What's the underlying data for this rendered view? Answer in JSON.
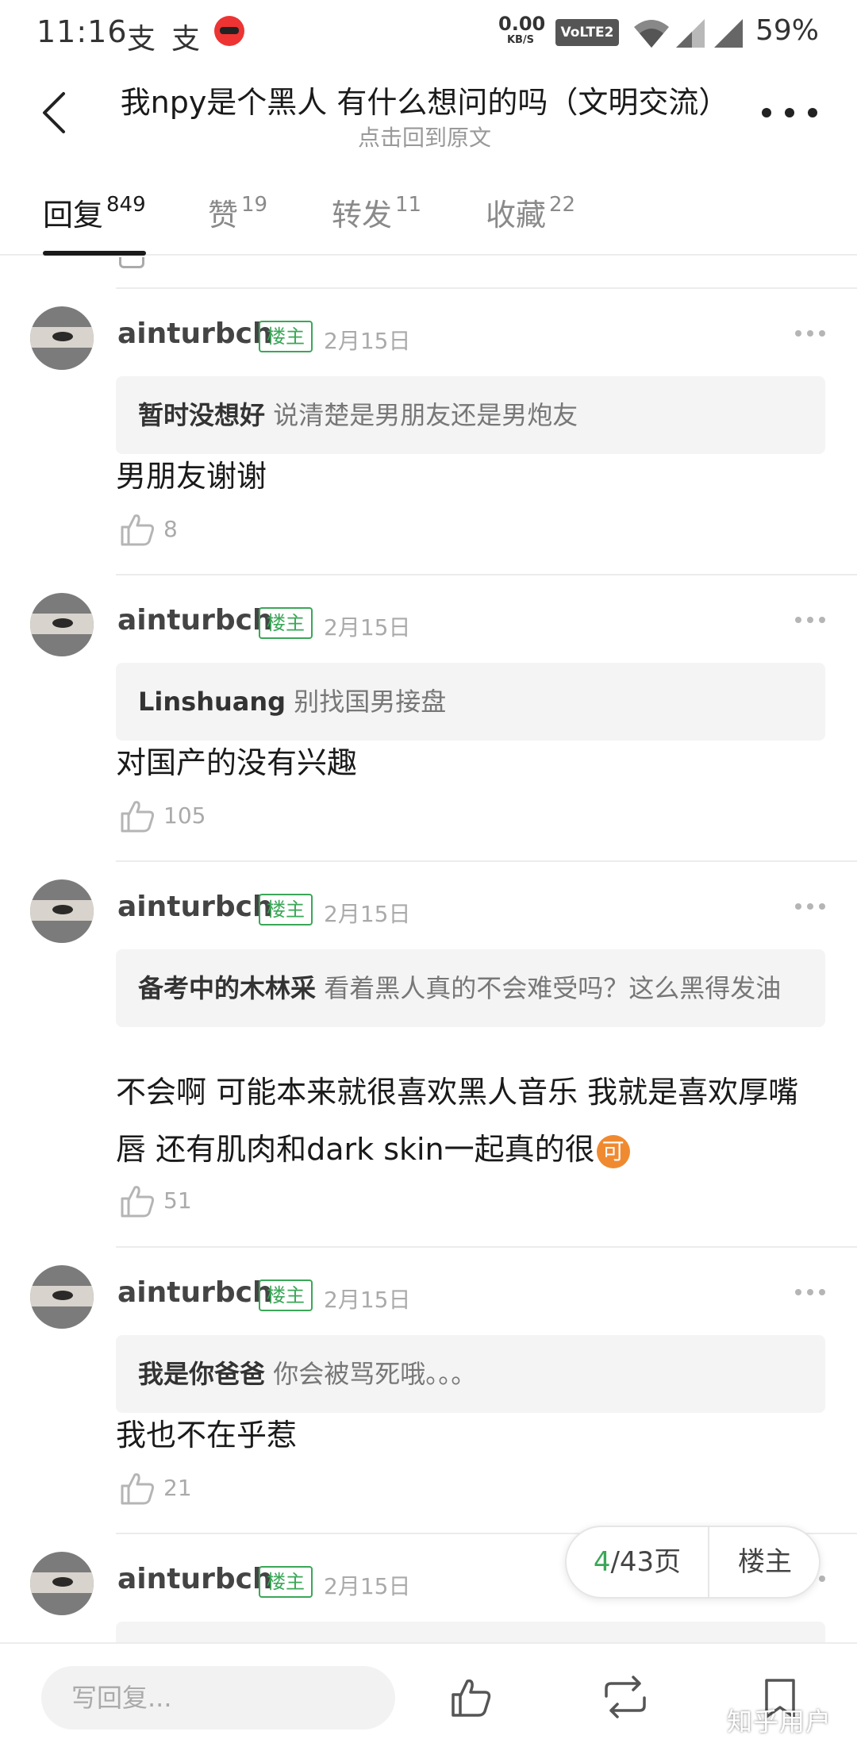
{
  "status_bar": {
    "time": "11:16",
    "notif_glyph": "支",
    "net_speed_value": "0.00",
    "net_speed_unit": "KB/S",
    "volte": "VoLTE2",
    "battery": "59%"
  },
  "header": {
    "title": "我npy是个黑人 有什么想问的吗（文明交流）",
    "subtitle": "点击回到原文"
  },
  "tabs": [
    {
      "label": "回复",
      "count": "849"
    },
    {
      "label": "赞",
      "count": "19"
    },
    {
      "label": "转发",
      "count": "11"
    },
    {
      "label": "收藏",
      "count": "22"
    }
  ],
  "comments": [
    {
      "user": "ainturbch",
      "badge": "楼主",
      "date": "2月15日",
      "quote_user": "暂时没想好",
      "quote_text": "说清楚是男朋友还是男炮友",
      "text": "男朋友谢谢",
      "likes": "8"
    },
    {
      "user": "ainturbch",
      "badge": "楼主",
      "date": "2月15日",
      "quote_user": "Linshuang",
      "quote_text": "别找国男接盘",
      "text": "对国产的没有兴趣",
      "likes": "105"
    },
    {
      "user": "ainturbch",
      "badge": "楼主",
      "date": "2月15日",
      "quote_user": "备考中的木林采",
      "quote_text": "看着黑人真的不会难受吗？这么黑得发油",
      "text": "不会啊 可能本来就很喜欢黑人音乐 我就是喜欢厚嘴唇 还有肌肉和dark skin一起真的很",
      "emoji": "可",
      "likes": "51"
    },
    {
      "user": "ainturbch",
      "badge": "楼主",
      "date": "2月15日",
      "quote_user": "我是你爸爸",
      "quote_text": "你会被骂死哦。。。",
      "text": "我也不在乎惹",
      "likes": "21"
    },
    {
      "user": "ainturbch",
      "badge": "楼主",
      "date": "2月15日"
    }
  ],
  "page_pill": {
    "current": "4",
    "total_text": "/43页",
    "author_label": "楼主"
  },
  "bottom_bar": {
    "reply_placeholder": "写回复...",
    "watermark": "知乎用户"
  },
  "colors": {
    "accent_green": "#3aa757",
    "text_primary": "#1a1a1a",
    "text_muted": "#aaaaaa",
    "quote_bg": "#f4f4f4",
    "emoji_orange": "#f08a30"
  },
  "icons": [
    "back-arrow-icon",
    "more-dots-icon",
    "thumbs-up-icon",
    "repost-icon",
    "favorite-icon",
    "wifi-icon",
    "signal-icon"
  ]
}
